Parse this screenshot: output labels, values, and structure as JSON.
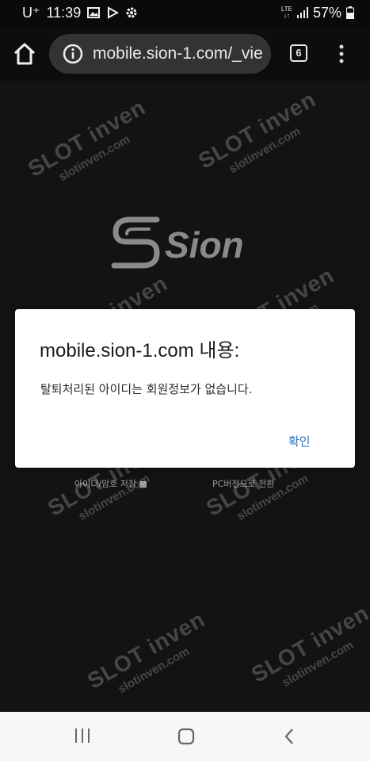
{
  "status_bar": {
    "carrier": "U⁺",
    "time": "11:39",
    "network": "LTE",
    "battery": "57%"
  },
  "browser": {
    "url": "mobile.sion-1.com/_vie",
    "tab_count": "6"
  },
  "page": {
    "logo_text": "Sion",
    "save_id_label": "아이디/암호 저장 ■",
    "pc_version_label": "PC버전으로 전환"
  },
  "dialog": {
    "title": "mobile.sion-1.com 내용:",
    "message": "탈퇴처리된 아이디는 회원정보가 없습니다.",
    "ok_label": "확인"
  },
  "watermark": {
    "title": "SLOT inven",
    "subtitle": "slotinven.com"
  },
  "colors": {
    "dialog_button": "#1a73c8",
    "page_background": "#131313"
  }
}
